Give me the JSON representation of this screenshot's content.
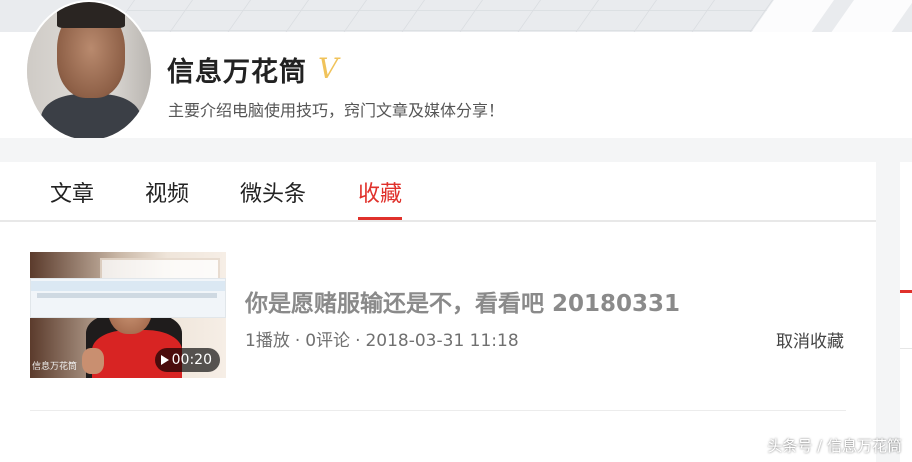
{
  "profile": {
    "username": "信息万花筒",
    "verified_badge": "V",
    "bio": "主要介绍电脑使用技巧，窍门文章及媒体分享！"
  },
  "tabs": [
    {
      "label": "文章",
      "active": false
    },
    {
      "label": "视频",
      "active": false
    },
    {
      "label": "微头条",
      "active": false
    },
    {
      "label": "收藏",
      "active": true
    }
  ],
  "items": [
    {
      "thumbnail_watermark": "信息万花筒",
      "duration": "00:20",
      "title": "你是愿赌服输还是不，看看吧 20180331",
      "plays": "1播放",
      "comments": "0评论",
      "date": "2018-03-31 11:18",
      "action": "取消收藏"
    }
  ],
  "watermark": "头条号 / 信息万花筒",
  "colors": {
    "accent": "#e0312b",
    "verified": "#f0c35b"
  }
}
